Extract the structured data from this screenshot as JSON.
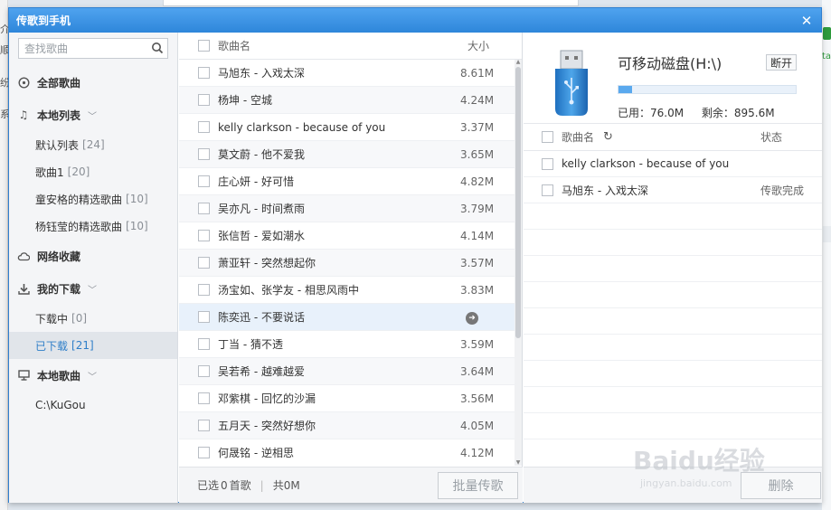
{
  "dialog": {
    "title": "传歌到手机"
  },
  "search": {
    "placeholder": "查找歌曲"
  },
  "sidebar": {
    "groups": [
      {
        "label": "全部歌曲",
        "icon": "disc-icon"
      },
      {
        "label": "本地列表",
        "icon": "music-note-icon",
        "items": [
          {
            "label": "默认列表",
            "count": "[24]"
          },
          {
            "label": "歌曲1",
            "count": "[20]"
          },
          {
            "label": "童安格的精选歌曲",
            "count": "[10]"
          },
          {
            "label": "杨钰莹的精选歌曲",
            "count": "[10]"
          }
        ]
      },
      {
        "label": "网络收藏",
        "icon": "cloud-icon"
      },
      {
        "label": "我的下载",
        "icon": "download-icon",
        "items": [
          {
            "label": "下载中",
            "count": "[0]"
          },
          {
            "label": "已下载",
            "count": "[21]"
          }
        ]
      },
      {
        "label": "本地歌曲",
        "icon": "computer-icon",
        "items": [
          {
            "label": "C:\\KuGou",
            "count": ""
          }
        ]
      }
    ]
  },
  "song_list": {
    "header": {
      "name": "歌曲名",
      "size": "大小"
    },
    "rows": [
      {
        "name": "马旭东 - 入戏太深",
        "size": "8.61M"
      },
      {
        "name": "杨坤 - 空城",
        "size": "4.24M"
      },
      {
        "name": "kelly clarkson - because of you",
        "size": "3.37M"
      },
      {
        "name": "莫文蔚 - 他不爱我",
        "size": "3.65M"
      },
      {
        "name": "庄心妍 - 好可惜",
        "size": "4.82M"
      },
      {
        "name": "吴亦凡 - 时间煮雨",
        "size": "3.79M"
      },
      {
        "name": "张信哲 - 爱如潮水",
        "size": "4.14M"
      },
      {
        "name": "萧亚轩 - 突然想起你",
        "size": "3.57M"
      },
      {
        "name": "汤宝如、张学友 - 相思风雨中",
        "size": "3.83M"
      },
      {
        "name": "陈奕迅 - 不要说话",
        "size": ""
      },
      {
        "name": "丁当 - 猜不透",
        "size": "3.59M"
      },
      {
        "name": "吴若希 - 越难越爱",
        "size": "3.64M"
      },
      {
        "name": "邓紫棋 - 回忆的沙漏",
        "size": "3.56M"
      },
      {
        "name": "五月天 - 突然好想你",
        "size": "4.05M"
      },
      {
        "name": "何晟铭 - 逆相思",
        "size": "4.12M"
      }
    ],
    "footer": {
      "selected_prefix": "已选",
      "selected_count": "0",
      "selected_suffix": "首歌",
      "total_prefix": "共",
      "total_size": "0M",
      "batch_button": "批量传歌"
    }
  },
  "device": {
    "name": "可移动磁盘(H:\\)",
    "disconnect_button": "断开",
    "used_label": "已用：76.0M",
    "free_label": "剩余：895.6M",
    "used_fraction": 0.078,
    "colors": {
      "bar_fill": "#5aa9ee",
      "bar_track": "#e9f1fa"
    }
  },
  "transfer_list": {
    "header": {
      "name": "歌曲名",
      "status": "状态"
    },
    "rows": [
      {
        "name": "kelly clarkson - because of you",
        "status": ""
      },
      {
        "name": "马旭东 - 入戏太深",
        "status": "传歌完成"
      }
    ],
    "delete_button": "删除"
  },
  "watermark": {
    "main": "Baidu经验",
    "sub": "jingyan.baidu.com"
  }
}
